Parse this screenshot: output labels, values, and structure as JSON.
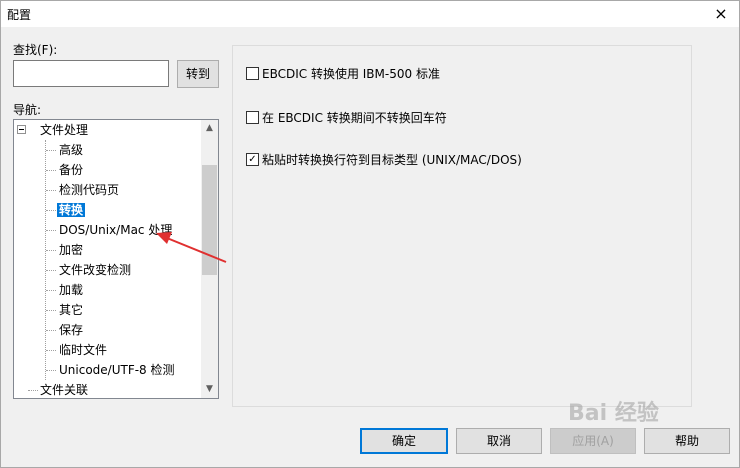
{
  "window": {
    "title": "配置",
    "close_icon": "×"
  },
  "search": {
    "label": "查找(F):",
    "value": "",
    "goto_label": "转到"
  },
  "navigation": {
    "label": "导航:",
    "items": [
      "文件处理",
      "高级",
      "备份",
      "检测代码页",
      "转换",
      "DOS/Unix/Mac 处理",
      "加密",
      "文件改变检测",
      "加载",
      "其它",
      "保存",
      "临时文件",
      "Unicode/UTF-8 检测",
      "文件关联"
    ],
    "selected": "转换"
  },
  "options": [
    {
      "label": "EBCDIC 转换使用 IBM-500 标准",
      "checked": false
    },
    {
      "label": "在 EBCDIC 转换期间不转换回车符",
      "checked": false
    },
    {
      "label": "粘贴时转换换行符到目标类型 (UNIX/MAC/DOS)",
      "checked": true
    }
  ],
  "buttons": {
    "ok": "确定",
    "cancel": "取消",
    "apply": "应用(A)",
    "help": "帮助"
  },
  "watermark": "Bai 经验",
  "colors": {
    "selection": "#0078d7",
    "annotation_arrow": "#e03030"
  }
}
